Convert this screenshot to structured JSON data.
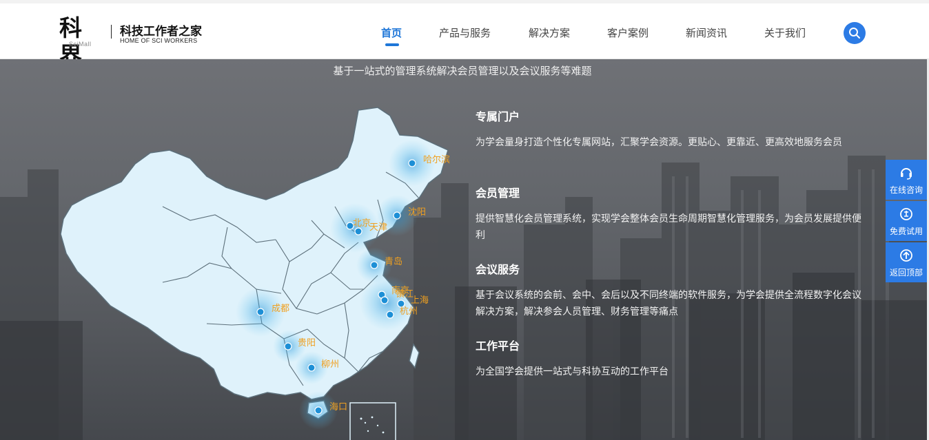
{
  "header": {
    "logo_main": "科界",
    "logo_sub": "SciMall",
    "logo_cn": "科技工作者之家",
    "logo_en": "HOME OF SCI WORKERS",
    "nav": [
      {
        "label": "首页",
        "active": true
      },
      {
        "label": "产品与服务"
      },
      {
        "label": "解决方案"
      },
      {
        "label": "客户案例"
      },
      {
        "label": "新闻资讯"
      },
      {
        "label": "关于我们"
      }
    ],
    "search_icon": "search-icon"
  },
  "hero": {
    "subtitle": "基于一站式的管理系统解决会员管理以及会议服务等难题",
    "cities": [
      "哈尔滨",
      "沈阳",
      "北京",
      "天津",
      "青岛",
      "南京",
      "镇江",
      "上海",
      "杭州",
      "成都",
      "贵阳",
      "柳州",
      "海口"
    ],
    "features": [
      {
        "title": "专属门户",
        "desc": "为学会量身打造个性化专属网站，汇聚学会资源。更贴心、更靠近、更高效地服务会员"
      },
      {
        "title": "会员管理",
        "desc": "提供智慧化会员管理系统，实现学会整体会员生命周期智慧化管理服务，为会员发展提供便利"
      },
      {
        "title": "会议服务",
        "desc": "基于会议系统的会前、会中、会后以及不同终端的软件服务，为学会提供全流程数字化会议解决方案，解决参会人员管理、财务管理等痛点"
      },
      {
        "title": "工作平台",
        "desc": "为全国学会提供一站式与科协互动的工作平台"
      }
    ]
  },
  "float_bar": [
    {
      "label": "在线咨询",
      "icon": "headset-icon"
    },
    {
      "label": "免费试用",
      "icon": "free-trial-icon"
    },
    {
      "label": "返回顶部",
      "icon": "arrow-up-icon"
    }
  ],
  "colors": {
    "accent": "#2c7be5",
    "city_label": "#f0a020",
    "map_fill": "#dff2fb"
  }
}
